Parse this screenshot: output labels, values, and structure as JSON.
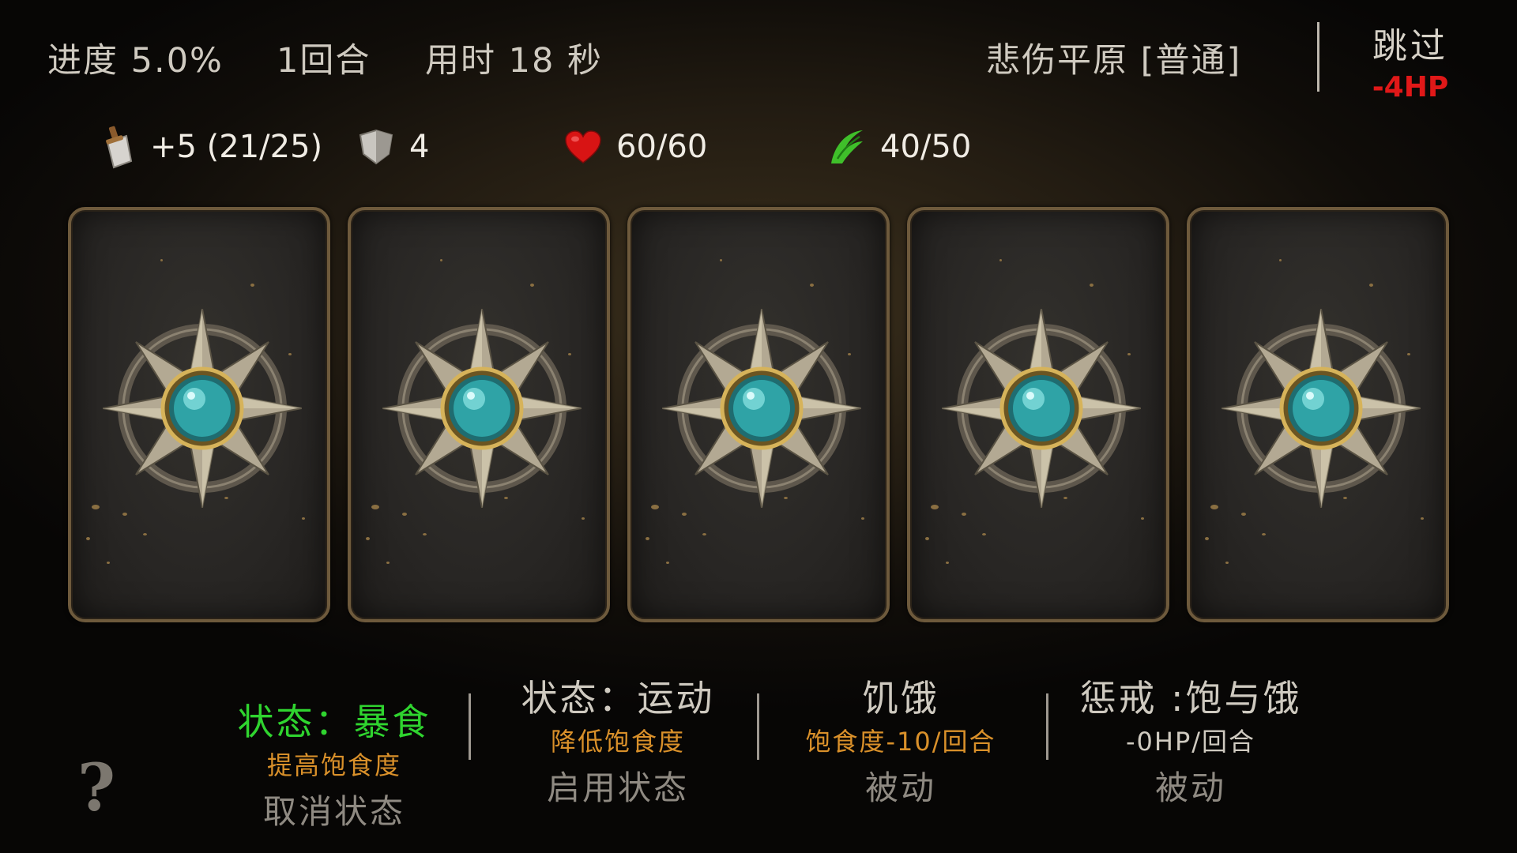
{
  "header": {
    "progress": "进度 5.0%",
    "round": "1回合",
    "time": "用时 18 秒",
    "location": "悲伤平原 [普通]",
    "skip_label": "跳过",
    "skip_cost": "-4HP"
  },
  "stats": {
    "attack": "+5 (21/25)",
    "armor": "4",
    "health": "60/60",
    "satiety": "40/50"
  },
  "cards": [
    {
      "icon": "compass-star-emblem-icon"
    },
    {
      "icon": "compass-star-emblem-icon"
    },
    {
      "icon": "compass-star-emblem-icon"
    },
    {
      "icon": "compass-star-emblem-icon"
    },
    {
      "icon": "compass-star-emblem-icon"
    }
  ],
  "statuses": [
    {
      "title": "状态：暴食",
      "desc": "提高饱食度",
      "action": "取消状态"
    },
    {
      "title": "状态：运动",
      "desc": "降低饱食度",
      "action": "启用状态"
    },
    {
      "title": "饥饿",
      "desc": "饱食度-10/回合",
      "action": "被动"
    },
    {
      "title": "惩戒 :饱与饿",
      "desc": "-0HP/回合",
      "action": "被动"
    }
  ],
  "help_label": "?",
  "colors": {
    "active_status": "#2fd42f",
    "desc_orange": "#d9902a",
    "skip_cost": "#e01818",
    "card_border": "#6e5a3c"
  }
}
